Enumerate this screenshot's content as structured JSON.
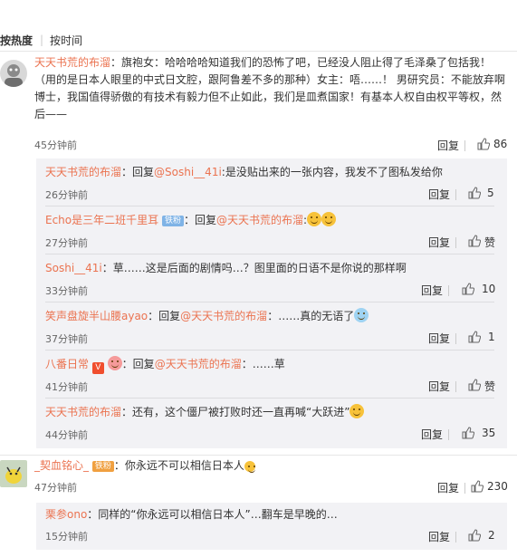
{
  "sort_tabs": [
    "按热度",
    "按时间"
  ],
  "actions": {
    "reply": "回复"
  },
  "comments": [
    {
      "user": "天天书荒的布溜",
      "text": "：旗袍女：哈哈哈哈知道我们的恐怖了吧，已经没人阻止得了毛泽桑了包括我！（用的是日本人眼里的中式日文腔，跟阿鲁差不多的那种）女主：唔……！ 男研究员：不能放弃啊博士，我国值得骄傲的有技术有毅力但不止如此，我们是皿煮国家！有基本人权自由权平等权，然后——",
      "time": "45分钟前",
      "likes": "86",
      "replies": [
        {
          "user": "天天书荒的布溜",
          "pre": "：回复",
          "mention": "@Soshi__41i",
          "text": ":是没贴出来的一张内容，我发不了图私发给你",
          "time": "26分钟前",
          "likes": "5"
        },
        {
          "user": "Echo是三年二班千里耳",
          "badge": "铁粉",
          "pre": "：回复",
          "mention": "@天天书荒的布溜",
          "text": ":",
          "time": "27分钟前",
          "likes": "赞"
        },
        {
          "user": "Soshi__41i",
          "pre": "",
          "mention": "",
          "text": "：草……这是后面的剧情吗…？图里面的日语不是你说的那样啊",
          "time": "33分钟前",
          "likes": "10"
        },
        {
          "user": "笑声盘旋半山腰ayao",
          "pre": "：回复",
          "mention": "@天天书荒的布溜",
          "text": "：……真的无语了",
          "time": "37分钟前",
          "likes": "1"
        },
        {
          "user": "八番日常",
          "pre": "：回复",
          "mention": "@天天书荒的布溜",
          "text": "：……草",
          "time": "41分钟前",
          "likes": "赞"
        },
        {
          "user": "天天书荒的布溜",
          "pre": "",
          "mention": "",
          "text": "：还有，这个僵尸被打败时还一直再喊“大跃进”",
          "time": "44分钟前",
          "likes": "35"
        }
      ]
    },
    {
      "user": "_契血铭心_",
      "badge": "铁粉",
      "text": "：你永远不可以相信日本人",
      "time": "47分钟前",
      "likes": "230",
      "replies": [
        {
          "user": "栗参ono",
          "pre": "",
          "mention": "",
          "text": "：同样的“你永远可以相信日本人”…翻车是早晚的…",
          "time": "15分钟前",
          "likes": "2"
        }
      ]
    }
  ]
}
